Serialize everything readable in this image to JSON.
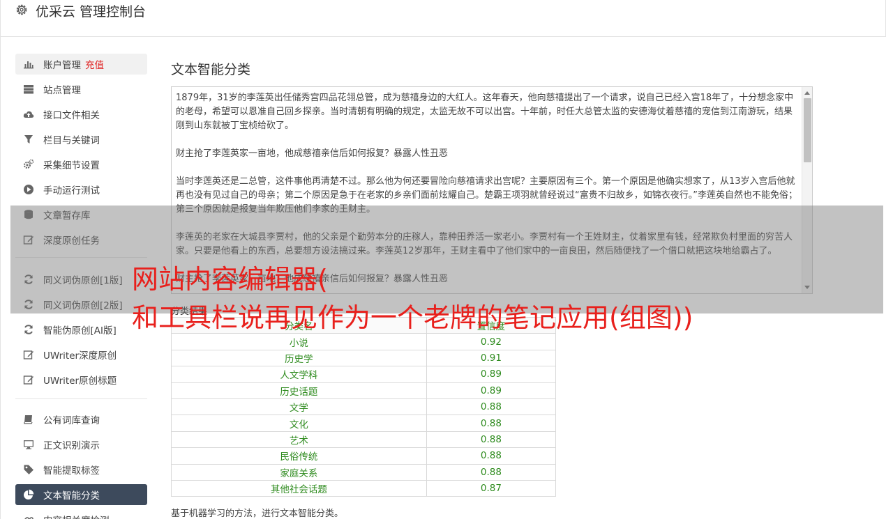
{
  "header": {
    "title": "优采云 管理控制台",
    "icon": "gear-icon"
  },
  "sidebar": {
    "items": [
      {
        "label": "账户管理",
        "extra": "充值",
        "icon": "bar-chart-icon"
      },
      {
        "label": "站点管理",
        "icon": "server-icon"
      },
      {
        "label": "接口文件相关",
        "icon": "cloud-upload-icon"
      },
      {
        "label": "栏目与关键词",
        "icon": "filter-icon"
      },
      {
        "label": "采集细节设置",
        "icon": "gears-icon"
      },
      {
        "label": "手动运行测试",
        "icon": "play-circle-icon"
      },
      {
        "label": "文章暂存库",
        "icon": "database-icon"
      },
      {
        "label": "深度原创任务",
        "icon": "edit-icon"
      },
      {
        "label": "同义词伪原创[1版]",
        "icon": "refresh-icon"
      },
      {
        "label": "同义词伪原创[2版]",
        "icon": "refresh-icon"
      },
      {
        "label": "智能伪原创[AI版]",
        "icon": "refresh-icon"
      },
      {
        "label": "UWriter深度原创",
        "icon": "edit-icon"
      },
      {
        "label": "UWriter原创标题",
        "icon": "edit-icon"
      },
      {
        "label": "公有词库查询",
        "icon": "book-icon"
      },
      {
        "label": "正文识别演示",
        "icon": "desktop-icon"
      },
      {
        "label": "智能提取标签",
        "icon": "tag-icon"
      },
      {
        "label": "文本智能分类",
        "icon": "pie-chart-icon"
      },
      {
        "label": "内容相关度检测",
        "icon": "link-icon"
      }
    ]
  },
  "main": {
    "title": "文本智能分类",
    "text_paragraphs": [
      "1879年，31岁的李莲英出任储秀宫四品花翎总管，成为慈禧身边的大红人。这年春天，他向慈禧提出了一个请求，说自己已经入宫18年了，十分想念家中的老母，希望可以恩准自己回乡探亲。当时清朝有明确的规定，太监无故不可以出宫。十年前，时任大总管太监的安德海仗着慈禧的宠信到江南游玩，结果刚到山东就被丁宝桢给砍了。",
      "财主抢了李莲英家一亩地，他成慈禧亲信后如何报复？暴露人性丑恶",
      "当时李莲英还是二总管，这件事他再清楚不过。那么他为何还要冒险向慈禧请求出宫呢？主要原因有三个。第一个原因是他确实想家了，从13岁入宫后他就再也没有见过自己的母亲；第二个原因是急于在老家的乡亲们面前炫耀自己。楚霸王项羽就曾经说过“富贵不归故乡，如锦衣夜行。”李莲英自然也不能免俗；第三个原因就是报复当年欺压他们李家的王财主。",
      "李莲英的老家在大城县李贾村，他的父亲是个勤劳本分的庄稼人，靠种田养活一家老小。李贾村有一个王姓财主，仗着家里有钱，经常欺负村里面的穷苦人家。只要是他看上的东西，总要想方设法搞过来。李莲英12岁那年，王财主看中了他们家中的一亩良田，然后随便找了一个借口就把这块地给霸占了。",
      "财主抢了李莲英家一亩地，他成慈禧亲信后如何报复？暴露人性丑恶"
    ],
    "table_label": "分类结果",
    "table": {
      "headers": [
        "分类名",
        "置信度"
      ],
      "rows": [
        [
          "小说",
          "0.92"
        ],
        [
          "历史学",
          "0.91"
        ],
        [
          "人文学科",
          "0.89"
        ],
        [
          "历史话题",
          "0.89"
        ],
        [
          "文学",
          "0.88"
        ],
        [
          "文化",
          "0.88"
        ],
        [
          "艺术",
          "0.88"
        ],
        [
          "民俗传统",
          "0.88"
        ],
        [
          "家庭关系",
          "0.88"
        ],
        [
          "其他社会话题",
          "0.87"
        ]
      ]
    },
    "footnote": "基于机器学习的方法，进行文本智能分类。"
  },
  "overlay": {
    "headline_line1": "网站内容编辑器(",
    "headline_line2": "和工具栏说再见作为一个老牌的笔记应用(组图))"
  },
  "colors": {
    "active_nav": "#3d4a5c",
    "accent_red": "#e02020",
    "result_green": "#2e8b1e"
  }
}
